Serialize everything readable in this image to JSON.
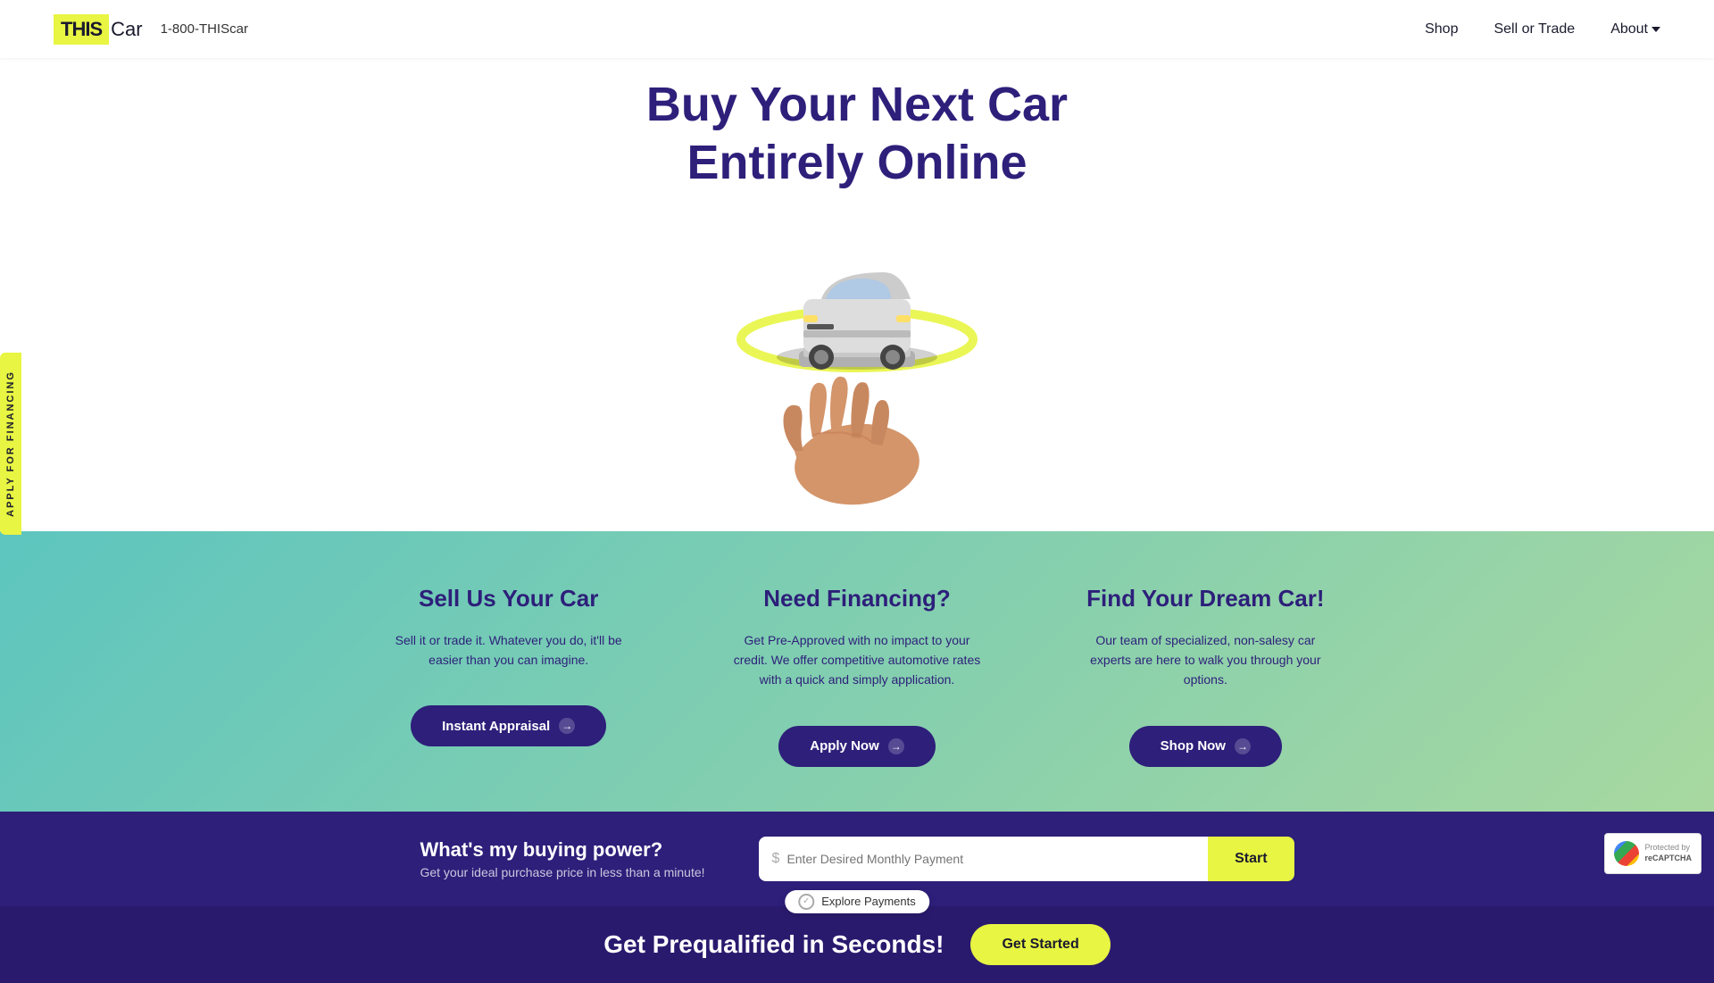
{
  "navbar": {
    "logo_this": "THIS",
    "logo_car": "Car",
    "phone": "1-800-THIScar",
    "links": [
      {
        "label": "Shop",
        "name": "shop-link",
        "has_dropdown": false
      },
      {
        "label": "Sell or Trade",
        "name": "sell-or-trade-link",
        "has_dropdown": false
      },
      {
        "label": "About",
        "name": "about-link",
        "has_dropdown": true
      }
    ]
  },
  "hero": {
    "title_line1": "Buy Your Next Car",
    "title_line2": "Entirely Online"
  },
  "features": [
    {
      "title": "Sell Us Your Car",
      "description": "Sell it or trade it. Whatever you do, it'll be easier than you can imagine.",
      "button_label": "Instant Appraisal",
      "name": "sell-feature"
    },
    {
      "title": "Need Financing?",
      "description": "Get Pre-Approved with no impact to your credit. We offer competitive automotive rates with a quick and simply application.",
      "button_label": "Apply Now",
      "name": "financing-feature"
    },
    {
      "title": "Find Your Dream Car!",
      "description": "Our team of specialized, non-salesy car experts are here to walk you through your options.",
      "button_label": "Shop Now",
      "name": "find-car-feature"
    }
  ],
  "buying_power": {
    "title": "What's my buying power?",
    "subtitle": "Get your ideal purchase price in less than a minute!",
    "input_placeholder": "Enter Desired Monthly Payment",
    "dollar_sign": "$",
    "button_label": "Start"
  },
  "bottom_banner": {
    "explore_label": "Explore Payments",
    "title": "Get Prequalified in Seconds!",
    "button_label": "Get Started"
  },
  "side_apply": {
    "label": "APPLY FOR FINANCING"
  },
  "colors": {
    "brand_purple": "#2d1f7a",
    "brand_yellow": "#e8f542",
    "gradient_start": "#5dc5bf",
    "gradient_end": "#a8d8a0"
  }
}
